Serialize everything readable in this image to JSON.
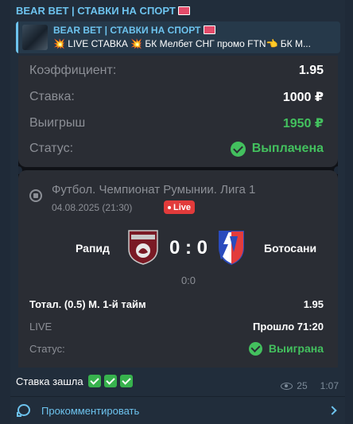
{
  "channel": {
    "name": "BEAR BET | СТАВКИ НА СПОРТ"
  },
  "reply": {
    "title": "BEAR BET | СТАВКИ НА СПОРТ",
    "text": "💥 LIVE СТАВКА 💥  БК Мелбет СНГ промо FTN👈  БК М..."
  },
  "bet_card": {
    "coef_label": "Коэффициент:",
    "coef_value": "1.95",
    "stake_label": "Ставка:",
    "stake_value": "1000 ₽",
    "win_label": "Выигрыш",
    "win_value": "1950 ₽",
    "status_label": "Статус:",
    "status_value": "Выплачена"
  },
  "match": {
    "league": "Футбол. Чемпионат Румынии. Лига 1",
    "date": "04.08.2025 (21:30)",
    "live_badge": "Live",
    "team1": "Рапид",
    "team2": "Ботосани",
    "score": "0 : 0",
    "sub_score": "0:0",
    "market": "Тотал. (0.5) М. 1-й тайм",
    "market_value": "1.95",
    "state_label": "LIVE",
    "state_value": "Прошло 71:20",
    "status_label": "Статус:",
    "status_value": "Выиграна"
  },
  "caption": {
    "text": "Ставка зашла"
  },
  "meta": {
    "views": "25",
    "time": "1:07"
  },
  "comment": {
    "label": "Прокомментировать"
  },
  "colors": {
    "accent": "#6dc3ee",
    "green": "#43c05e",
    "live": "#e23b3b"
  },
  "icons": [
    "flag-icon",
    "football-icon",
    "check-icon",
    "eye-icon",
    "comment-icon",
    "chevron-right-icon"
  ]
}
